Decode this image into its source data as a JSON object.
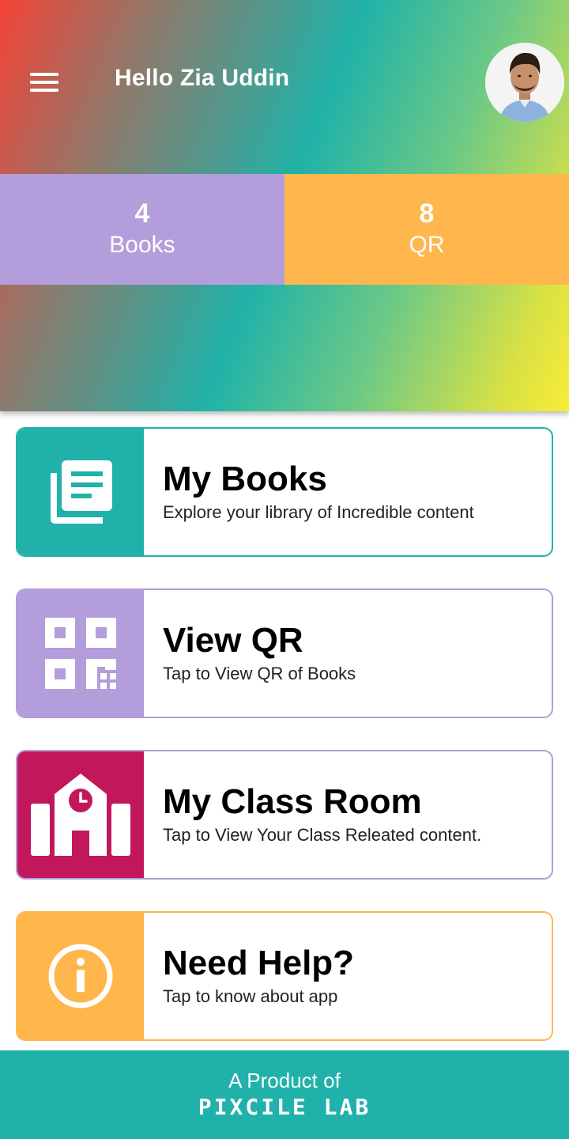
{
  "header": {
    "greeting": "Hello Zia Uddin",
    "menu_icon": "hamburger-menu-icon",
    "avatar_icon": "user-avatar"
  },
  "stats": {
    "books": {
      "count": "4",
      "label": "Books",
      "color": "#b39ddb"
    },
    "qr": {
      "count": "8",
      "label": "QR",
      "color": "#ffb74d"
    }
  },
  "cards": [
    {
      "title": "My Books",
      "subtitle": "Explore your library of Incredible content",
      "icon": "book-icon",
      "color": "#20b2aa",
      "border": "#20b2aa"
    },
    {
      "title": "View QR",
      "subtitle": "Tap to View QR of Books",
      "icon": "qr-code-icon",
      "color": "#b39ddb",
      "border": "#b39ddb"
    },
    {
      "title": "My Class Room",
      "subtitle": "Tap to View Your Class Releated content.",
      "icon": "school-icon",
      "color": "#c2185b",
      "border": "#b39ddb"
    },
    {
      "title": "Need Help?",
      "subtitle": "Tap to know about app",
      "icon": "info-icon",
      "color": "#ffb74d",
      "border": "#ffb74d"
    }
  ],
  "footer": {
    "prefix": "A Product of",
    "brand": "PIXCILE LAB",
    "color": "#20b2aa"
  }
}
